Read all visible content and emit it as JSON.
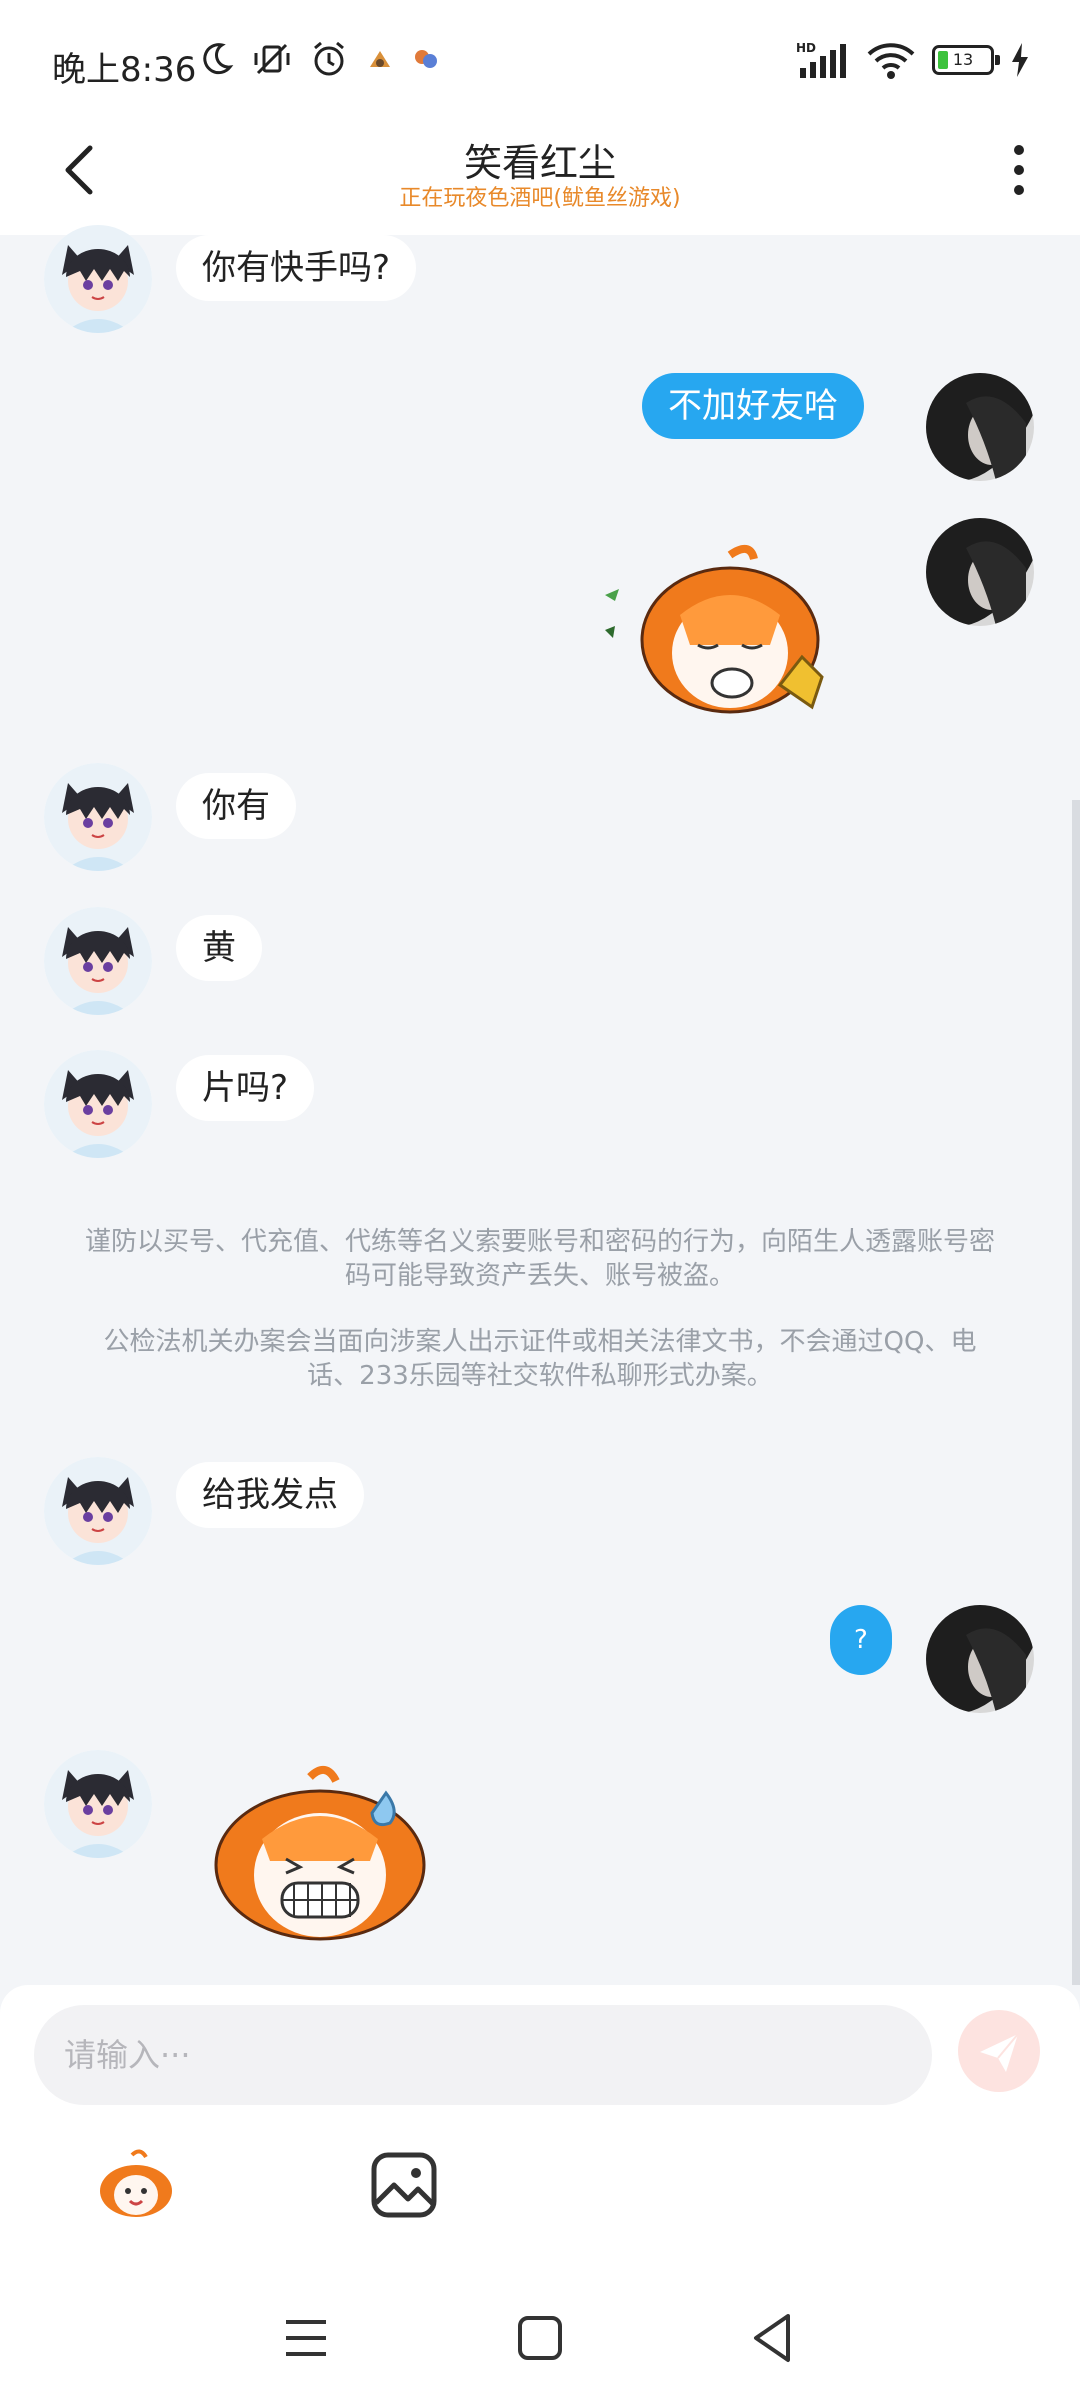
{
  "status": {
    "time": "晚上8:36",
    "network": "HD",
    "battery": "13"
  },
  "header": {
    "title": "笑看红尘",
    "subtitle": "正在玩夜色酒吧(鱿鱼丝游戏)"
  },
  "messages": [
    {
      "sender": "other",
      "text": "你有快手吗?"
    },
    {
      "sender": "me",
      "text": "不加好友哈"
    },
    {
      "sender": "me",
      "sticker": "shy-fox-sticker"
    },
    {
      "sender": "other",
      "text": "你有"
    },
    {
      "sender": "other",
      "text": "黄"
    },
    {
      "sender": "other",
      "text": "片吗?"
    },
    {
      "sender": "other",
      "text": "给我发点"
    },
    {
      "sender": "me",
      "text": "?"
    },
    {
      "sender": "other",
      "sticker": "grimace-fox-sticker"
    }
  ],
  "notice": {
    "line1": "谨防以买号、代充值、代练等名义索要账号和密码的行为，向陌生人透露账号密码可能导致资产丢失、账号被盗。",
    "line2": "公检法机关办案会当面向涉案人出示证件或相关法律文书，不会通过QQ、电话、233乐园等社交软件私聊形式办案。"
  },
  "composer": {
    "placeholder": "请输入···"
  },
  "colors": {
    "accent_blue": "#27a7f0",
    "subtitle_orange": "#e8892a",
    "chat_bg": "#f3f5f8",
    "send_disabled": "#fde3e0"
  }
}
